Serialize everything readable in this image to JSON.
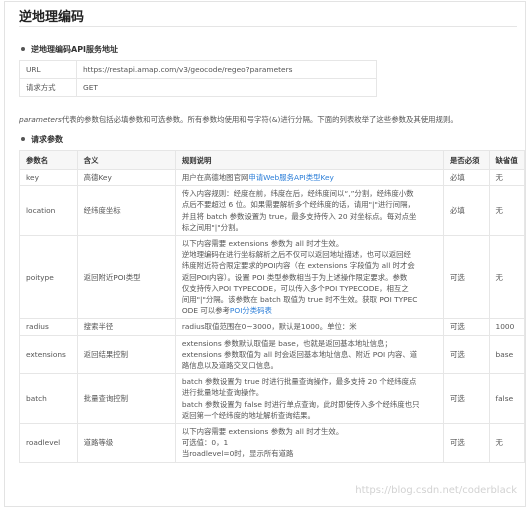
{
  "page": {
    "title": "逆地理编码"
  },
  "api_section": {
    "heading": "逆地理编码API服务地址",
    "rows": [
      {
        "key": "URL",
        "value": "https://restapi.amap.com/v3/geocode/regeo?parameters"
      },
      {
        "key": "请求方式",
        "value": "GET"
      }
    ]
  },
  "intro": {
    "param_word": "parameters",
    "text": "代表的参数包括必填参数和可选参数。所有参数均使用和号字符(&)进行分隔。下面的列表枚举了这些参数及其使用规则。"
  },
  "params_section": {
    "heading": "请求参数",
    "headers": [
      "参数名",
      "含义",
      "规则说明",
      "是否必须",
      "缺省值"
    ],
    "rows": [
      {
        "name": "key",
        "meaning": "高德Key",
        "rules": [
          "用户在高德地图官网"
        ],
        "link": "申请Web服务API类型Key",
        "required": "必填",
        "default": "无"
      },
      {
        "name": "location",
        "meaning": "经纬度坐标",
        "rules": [
          "传入内容规则：经度在前，纬度在后，经纬度间以“,”分割，经纬度小数",
          "点后不要超过 6 位。如果需要解析多个经纬度的话，请用\"|\"进行间隔，",
          "并且将 batch 参数设置为 true，最多支持传入 20 对坐标点。每对点坐",
          "标之间用\"|\"分割。"
        ],
        "required": "必填",
        "default": "无"
      },
      {
        "name": "poitype",
        "meaning": "返回附近POI类型",
        "rules": [
          "以下内容需要 extensions 参数为 all 时才生效。",
          "逆地理编码在进行坐标解析之后不仅可以返回地址描述，也可以返回经",
          "纬度附近符合限定要求的POI内容（在 extensions 字段值为 all 时才会",
          "返回POI内容）。设置 POI 类型参数相当于为上述操作限定要求。参数",
          "仅支持传入POI TYPECODE，可以传入多个POI TYPECODE，相互之",
          "间用\"|\"分隔。该参数在 batch 取值为 true 时不生效。获取 POI TYPEC",
          "ODE 可以参考"
        ],
        "link": "POI分类码表",
        "required": "可选",
        "default": "无"
      },
      {
        "name": "radius",
        "meaning": "搜索半径",
        "rules": [
          "radius取值范围在0~3000，默认是1000。单位：米"
        ],
        "required": "可选",
        "default": "1000"
      },
      {
        "name": "extensions",
        "meaning": "返回结果控制",
        "rules": [
          "extensions 参数默认取值是 base，也就是返回基本地址信息；",
          "extensions 参数取值为 all 时会返回基本地址信息、附近 POI 内容、道",
          "路信息以及道路交叉口信息。"
        ],
        "required": "可选",
        "default": "base"
      },
      {
        "name": "batch",
        "meaning": "批量查询控制",
        "rules": [
          "batch 参数设置为 true 时进行批量查询操作，最多支持 20 个经纬度点",
          "进行批量地址查询操作。",
          "batch 参数设置为 false 时进行单点查询，此时即使传入多个经纬度也只",
          "返回第一个经纬度的地址解析查询结果。"
        ],
        "required": "可选",
        "default": "false"
      },
      {
        "name": "roadlevel",
        "meaning": "道路等级",
        "rules": [
          "以下内容需要 extensions 参数为 all 时才生效。",
          "可选值：0，1",
          "当roadlevel=0时，显示所有道路"
        ],
        "required": "可选",
        "default": "无"
      }
    ]
  },
  "watermark": "https://blog.csdn.net/coderblack"
}
